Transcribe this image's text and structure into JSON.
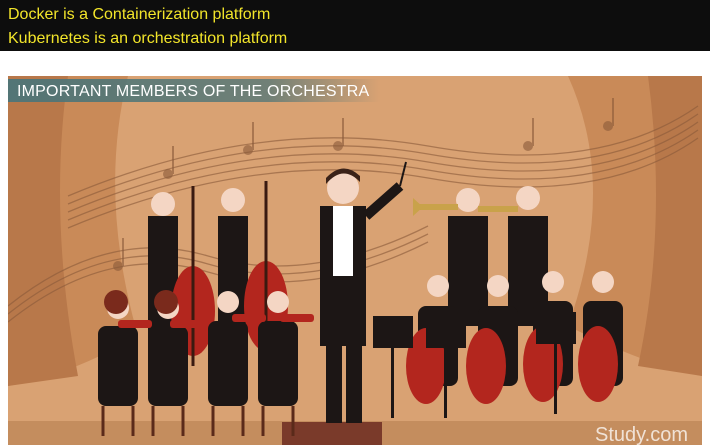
{
  "caption": {
    "line1": "Docker is a Containerization platform",
    "line2": "Kubernetes is an orchestration platform"
  },
  "slide": {
    "title": "IMPORTANT MEMBERS OF THE ORCHESTRA",
    "watermark": "Study.com",
    "colors": {
      "background": "#d9a273",
      "curtain": "#c98a58",
      "banner": "#4d7578",
      "caption_text": "#f2e52a",
      "musician_suit": "#1c1615",
      "instrument": "#b3261e",
      "skin": "#f4d6c4"
    }
  }
}
